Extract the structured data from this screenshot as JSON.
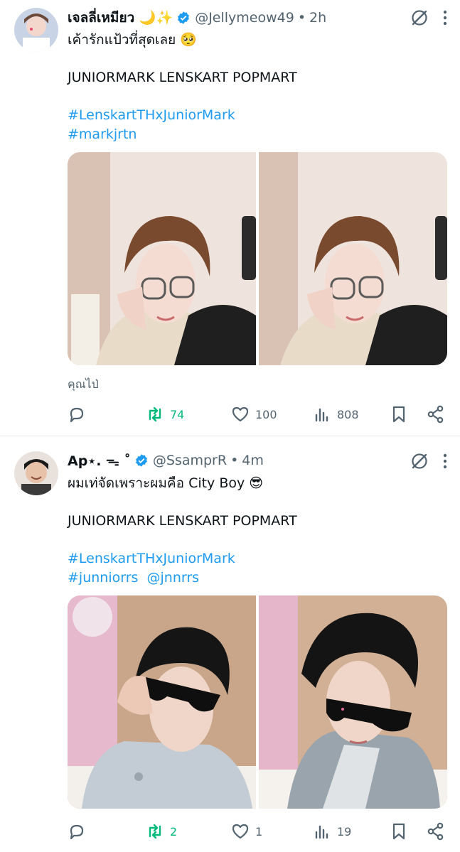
{
  "tweets": [
    {
      "display_name": "เจลลี่เหมียว 🌙✨",
      "handle": "@Jellymeow49",
      "separator": "•",
      "time": "2h",
      "text_line1": "เค้ารักแป้วที่สุดเลย 🥺",
      "text_line2": "JUNIORMARK LENSKART POPMART",
      "hashtag1": "#LenskartTHxJuniorMark",
      "hashtag2": "#markjrtn",
      "translate": "คุณไป่",
      "retweets": "74",
      "likes": "100",
      "views": "808",
      "retweet_state": "retweeted-green"
    },
    {
      "display_name": "Ap⋆. ᯓ ˚",
      "handle": "@SsamprR",
      "separator": "•",
      "time": "4m",
      "text_line1": "ผมเท่จัดเพราะผมคือ City Boy 😎",
      "text_line2": "JUNIORMARK LENSKART POPMART",
      "hashtag1": "#LenskartTHxJuniorMark",
      "hashtag2": "#junniorrs",
      "mention": "@jnnrrs",
      "retweets": "2",
      "likes": "1",
      "views": "19",
      "retweet_state": "retweeted-green"
    }
  ],
  "icons": [
    "reply-icon",
    "retweet-icon",
    "like-icon",
    "views-icon",
    "bookmark-icon",
    "share-icon",
    "grok-icon",
    "more-icon",
    "verified-badge-icon"
  ],
  "colors": {
    "link": "#1d9bf0",
    "retweet_active": "#00ba7c",
    "muted": "#536471",
    "verified": "#1d9bf0"
  }
}
